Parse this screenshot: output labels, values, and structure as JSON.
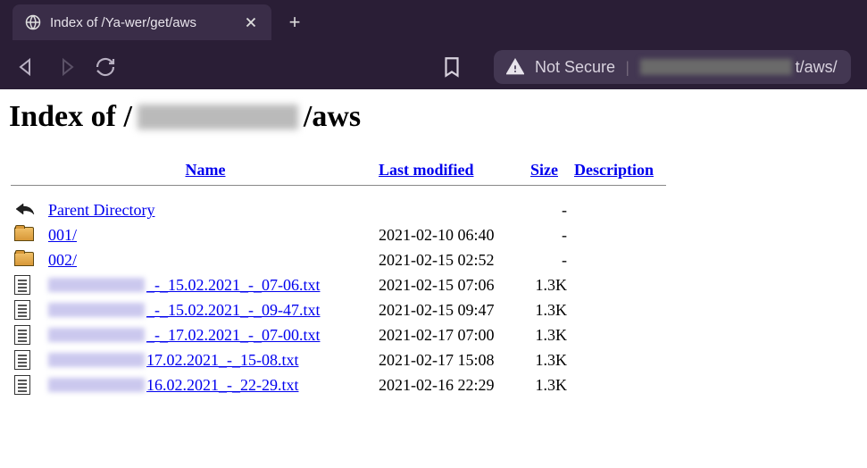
{
  "chrome": {
    "tab_title": "Index of /Ya-wer/get/aws",
    "not_secure": "Not Secure",
    "url_suffix": "t/aws/"
  },
  "page": {
    "heading_prefix": "Index of /",
    "heading_suffix": "/aws"
  },
  "headers": {
    "name": "Name",
    "modified": "Last modified",
    "size": "Size",
    "description": "Description"
  },
  "entries": [
    {
      "type": "parent",
      "name": "Parent Directory",
      "modified": "",
      "size": "-",
      "obscured": false
    },
    {
      "type": "dir",
      "name": "001/",
      "modified": "2021-02-10 06:40",
      "size": "-",
      "obscured": false
    },
    {
      "type": "dir",
      "name": "002/",
      "modified": "2021-02-15 02:52",
      "size": "-",
      "obscured": false
    },
    {
      "type": "file",
      "obscured": true,
      "name_suffix": "_-_15.02.2021_-_07-06.txt",
      "modified": "2021-02-15 07:06",
      "size": "1.3K"
    },
    {
      "type": "file",
      "obscured": true,
      "name_suffix": "_-_15.02.2021_-_09-47.txt",
      "modified": "2021-02-15 09:47",
      "size": "1.3K"
    },
    {
      "type": "file",
      "obscured": true,
      "name_suffix": "_-_17.02.2021_-_07-00.txt",
      "modified": "2021-02-17 07:00",
      "size": "1.3K"
    },
    {
      "type": "file",
      "obscured": true,
      "name_suffix": "17.02.2021_-_15-08.txt",
      "modified": "2021-02-17 15:08",
      "size": "1.3K"
    },
    {
      "type": "file",
      "obscured": true,
      "name_suffix": "16.02.2021_-_22-29.txt",
      "modified": "2021-02-16 22:29",
      "size": "1.3K"
    }
  ]
}
